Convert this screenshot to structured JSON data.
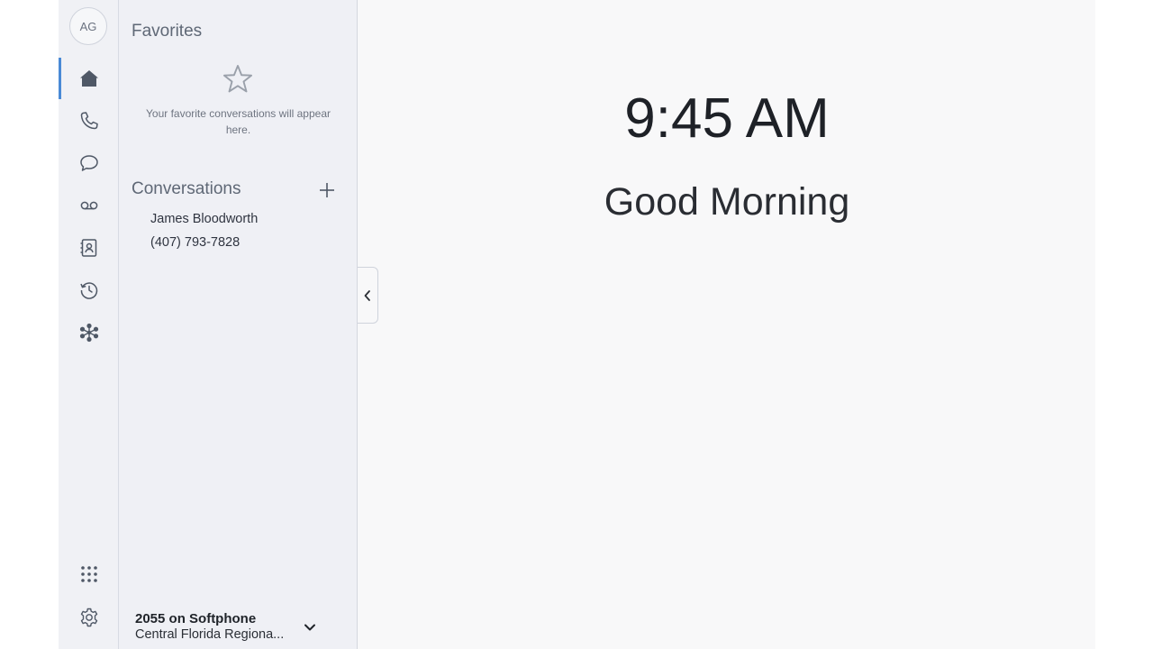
{
  "user": {
    "initials": "AG"
  },
  "rail": {
    "items": [
      {
        "icon": "home-icon",
        "active": true
      },
      {
        "icon": "phone-icon",
        "active": false
      },
      {
        "icon": "chat-icon",
        "active": false
      },
      {
        "icon": "voicemail-icon",
        "active": false
      },
      {
        "icon": "contacts-icon",
        "active": false
      },
      {
        "icon": "history-icon",
        "active": false
      },
      {
        "icon": "apps-asterisk-icon",
        "active": false
      }
    ],
    "bottom": [
      {
        "icon": "dialpad-icon"
      },
      {
        "icon": "settings-gear-icon"
      }
    ]
  },
  "favorites": {
    "title": "Favorites",
    "empty_text": "Your favorite conversations will appear here."
  },
  "conversations": {
    "title": "Conversations",
    "items": [
      {
        "label": "James Bloodworth"
      },
      {
        "label": "(407) 793-7828"
      }
    ]
  },
  "phone_line": {
    "title": "2055 on Softphone",
    "subtitle": "Central Florida Regiona..."
  },
  "main": {
    "time": "9:45 AM",
    "greeting": "Good Morning"
  },
  "colors": {
    "accent": "#4a8ad6",
    "rail_bg": "#f0f1f5",
    "panel_bg": "#eff0f5",
    "main_bg": "#f8f8f9",
    "icon": "#4f5866"
  }
}
